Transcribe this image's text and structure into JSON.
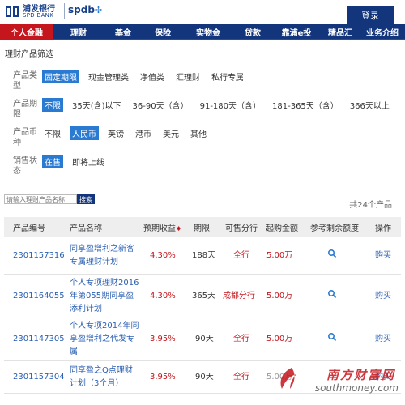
{
  "header": {
    "logo_cn": "浦发银行",
    "logo_en": "SPD BANK",
    "brand": "spdb",
    "login_label": "登录"
  },
  "nav": {
    "items": [
      {
        "label": "个人金融",
        "active": true
      },
      {
        "label": "理财",
        "active": false
      },
      {
        "label": "基金",
        "active": false
      },
      {
        "label": "保险",
        "active": false
      },
      {
        "label": "实物金",
        "active": false
      },
      {
        "label": "贷款",
        "active": false
      },
      {
        "label": "靠浦e投",
        "active": false
      },
      {
        "label": "精品汇",
        "active": false
      },
      {
        "label": "业务介绍",
        "active": false
      }
    ]
  },
  "filter": {
    "title": "理财产品筛选",
    "rows": [
      {
        "label": "产品类型",
        "options": [
          "固定期限",
          "现金管理类",
          "净值类",
          "汇理财",
          "私行专属"
        ],
        "selected": "固定期限"
      },
      {
        "label": "产品期限",
        "options": [
          "不限",
          "35天(含)以下",
          "36-90天（含）",
          "91-180天（含）",
          "181-365天（含）",
          "366天以上"
        ],
        "selected": "不限"
      },
      {
        "label": "产品币种",
        "options": [
          "不限",
          "人民币",
          "英镑",
          "港币",
          "美元",
          "其他"
        ],
        "selected": "人民币"
      },
      {
        "label": "销售状态",
        "options": [
          "在售",
          "即将上线"
        ],
        "selected": "在售"
      }
    ]
  },
  "search": {
    "placeholder": "请输入理财产品名称",
    "button_label": "搜索",
    "total": "共24个产品"
  },
  "table": {
    "headers": [
      "产品编号",
      "产品名称",
      "预期收益",
      "期限",
      "可售分行",
      "起购金额",
      "参考剩余额度",
      "操作"
    ],
    "sort_marker": "♦",
    "rows": [
      {
        "code": "2301157316",
        "name": "同享盈增利之新客专属理财计划",
        "rate": "4.30%",
        "term": "188天",
        "branch": "全行",
        "min": "5.00万",
        "action": "购买"
      },
      {
        "code": "2301164055",
        "name": "个人专项理财2016年第055期同享盈添利计划",
        "rate": "4.30%",
        "term": "365天",
        "branch": "成都分行",
        "min": "5.00万",
        "action": "购买"
      },
      {
        "code": "2301147305",
        "name": "个人专项2014年同享盈增利之代发专属",
        "rate": "3.95%",
        "term": "90天",
        "branch": "全行",
        "min": "5.00万",
        "action": "购买"
      },
      {
        "code": "2301157304",
        "name": "同享盈之Q点理财计划（3个月）",
        "rate": "3.95%",
        "term": "90天",
        "branch": "全行",
        "min": "5.00万",
        "action": "购买"
      }
    ]
  },
  "watermark": {
    "cn": "南方财富网",
    "en": "southmoney.com"
  },
  "colors": {
    "navy": "#13357c",
    "red": "#c4161c",
    "blue": "#2a7ad2",
    "link": "#2a5fb2"
  }
}
